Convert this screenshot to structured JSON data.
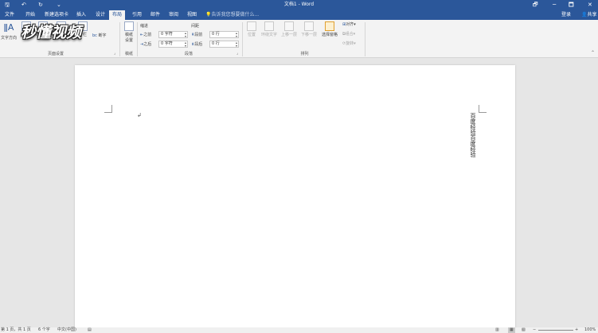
{
  "window": {
    "title": "文档1 - Word",
    "controls": {
      "restore": "🗗",
      "minimize": "─",
      "maximize": "🗖",
      "close": "✕"
    }
  },
  "quick_access": {
    "save": "🖫",
    "undo": "↶",
    "redo": "↻",
    "customize": "⌄"
  },
  "tabs": [
    {
      "label": "文件",
      "active": false
    },
    {
      "label": "开始",
      "active": false
    },
    {
      "label": "新建选项卡",
      "active": false
    },
    {
      "label": "插入",
      "active": false
    },
    {
      "label": "设计",
      "active": false
    },
    {
      "label": "布局",
      "active": true
    },
    {
      "label": "引用",
      "active": false
    },
    {
      "label": "邮件",
      "active": false
    },
    {
      "label": "审阅",
      "active": false
    },
    {
      "label": "视图",
      "active": false
    }
  ],
  "tell_me": "告诉我您想要做什么...",
  "login": "登录",
  "share": "共享",
  "ribbon": {
    "page_setup": {
      "label": "页面设置",
      "text_direction": "文字方向",
      "margins": "页边距",
      "orientation": "纸张方向",
      "size": "纸张大小",
      "columns": "分栏",
      "breaks": "分隔符",
      "hyphenation": "断字"
    },
    "draft": {
      "label": "稿纸",
      "button_line1": "稿纸",
      "button_line2": "设置"
    },
    "paragraph": {
      "label": "段落",
      "indent_header": "缩进",
      "spacing_header": "间距",
      "before_label": "之前",
      "after_label": "之后",
      "indent_left_value": "0 字符",
      "indent_right_value": "0 字符",
      "spacing_before_label": "段前",
      "spacing_after_label": "段后",
      "spacing_before_value": "0 行",
      "spacing_after_value": "0 行"
    },
    "arrange": {
      "label": "排列",
      "position": "位置",
      "wrap_text": "环绕文字",
      "bring_forward": "上移一层",
      "send_backward": "下移一层",
      "selection_pane": "选择窗格",
      "align": "对齐",
      "group": "组合",
      "rotate": "旋转"
    }
  },
  "document": {
    "vertical_text": "百度经验百度经验"
  },
  "status": {
    "page": "第 1 页，共 1 页",
    "words": "6 个字",
    "language": "中文(中国)",
    "zoom": "100%"
  },
  "watermark_text": "秒懂视频"
}
